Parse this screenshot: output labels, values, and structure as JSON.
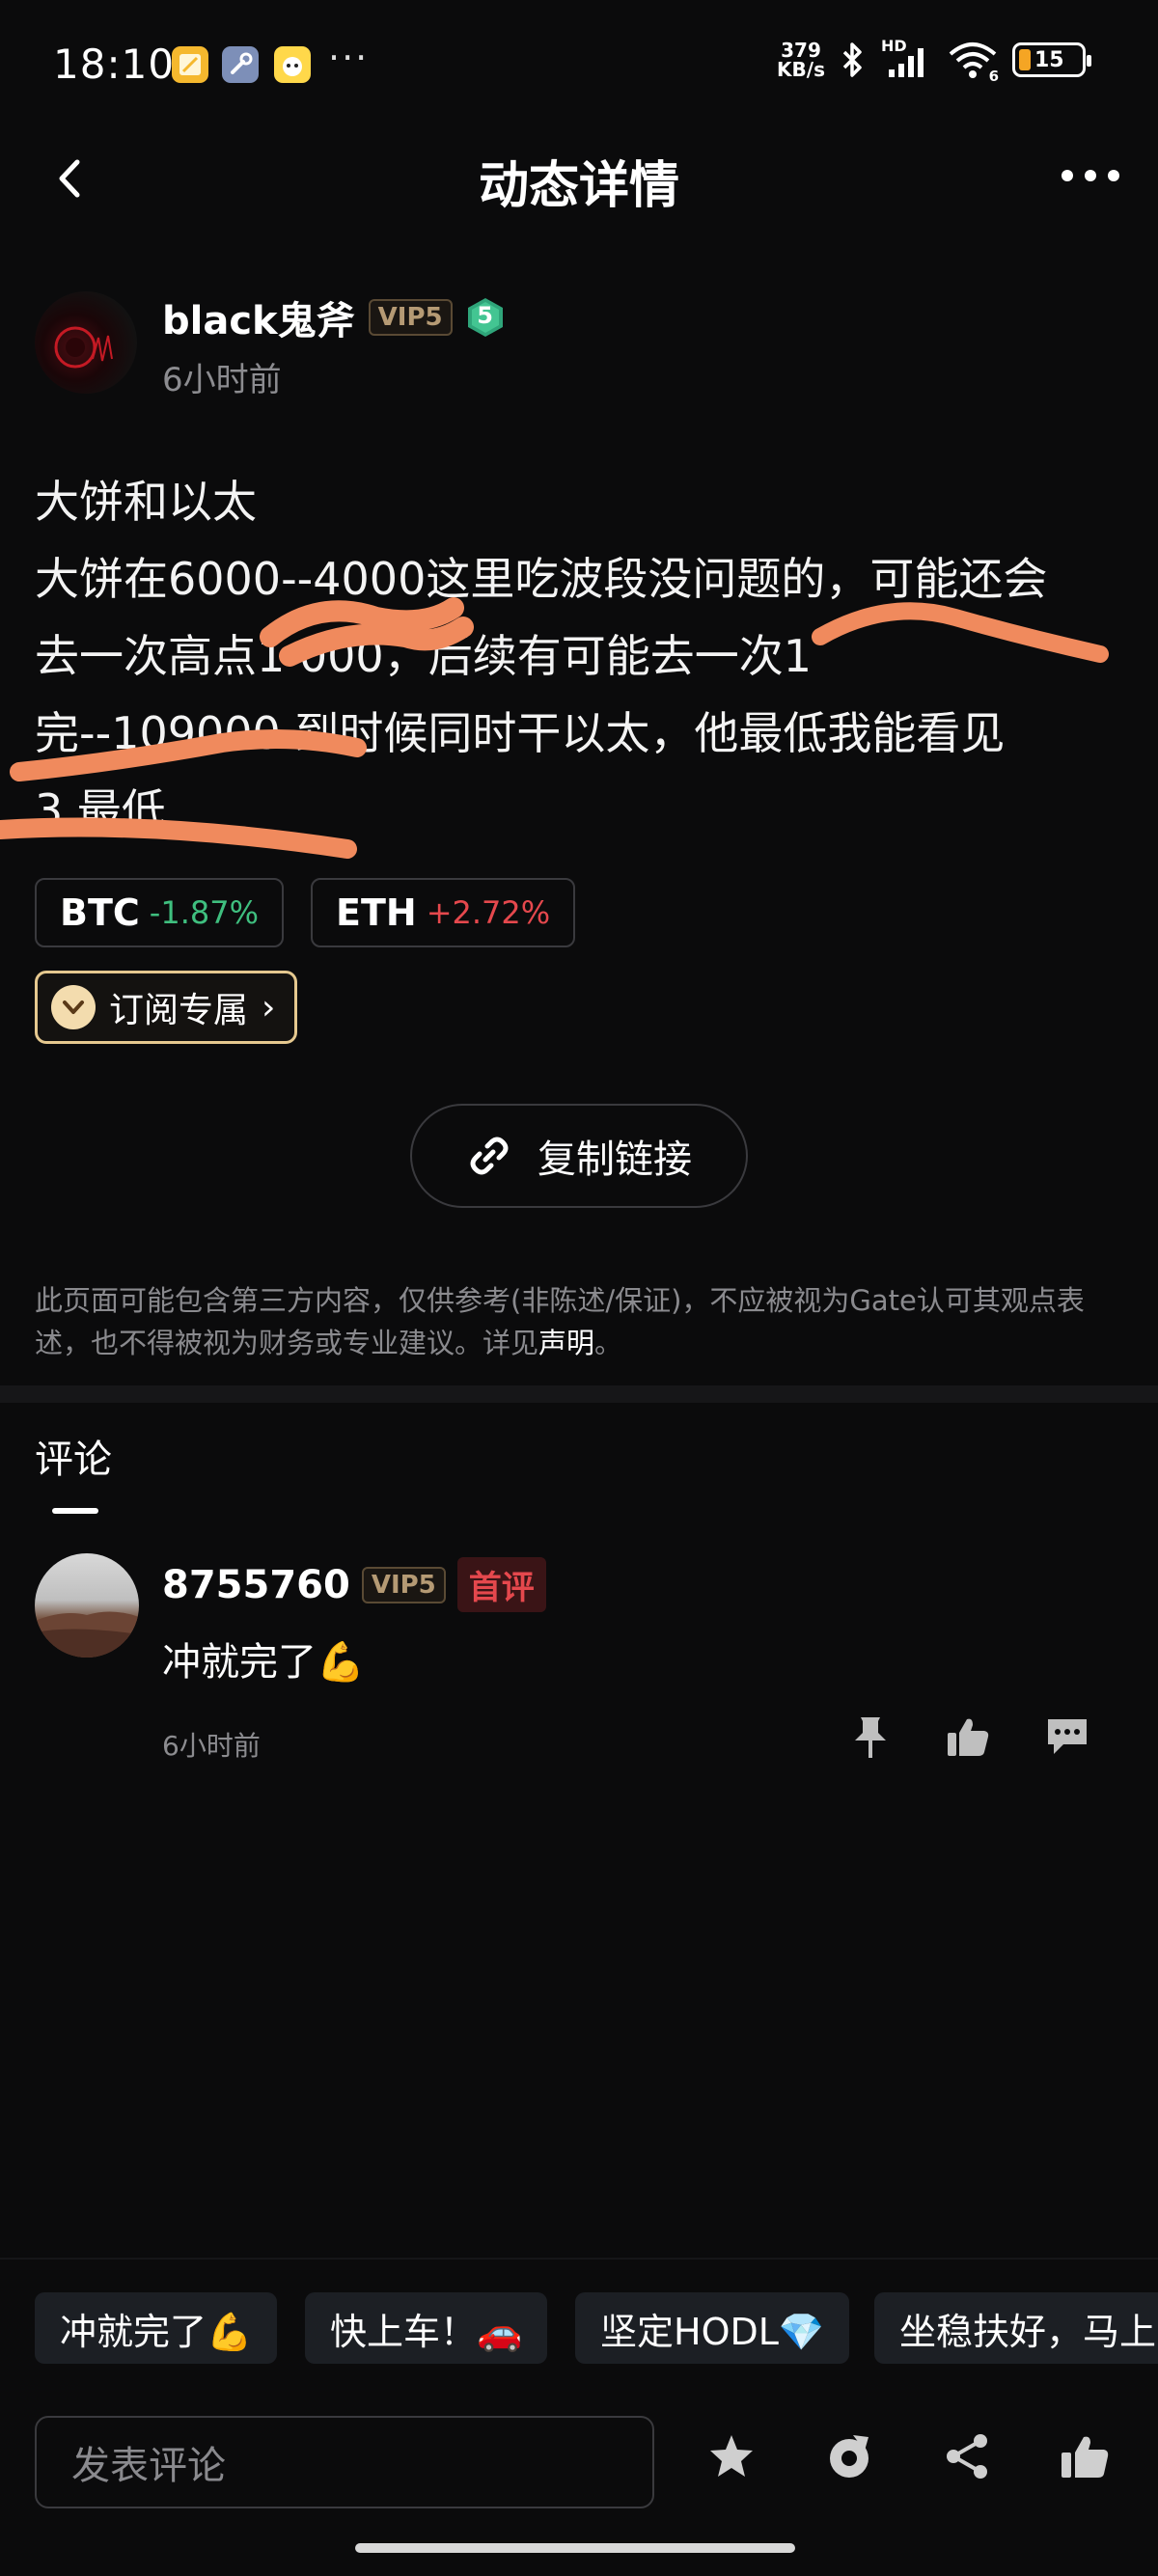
{
  "status_bar": {
    "time": "18:10",
    "net_speed_value": "379",
    "net_speed_unit": "KB/s",
    "battery": "15",
    "hd_label": "HD",
    "wifi_badge": "6",
    "more": "···"
  },
  "header": {
    "title": "动态详情"
  },
  "author": {
    "name": "black鬼斧",
    "vip": "VIP5",
    "level": "5",
    "time": "6小时前"
  },
  "post": {
    "lines": [
      "大饼和以太",
      "大饼在6000--4000这里吃波段没问题的，可能还会",
      "去一次高点1  000，后续有可能去一次1",
      "完--109000 到时候同时干以太，他最低我能看见",
      "3  最低"
    ]
  },
  "coins": [
    {
      "name": "BTC",
      "change": "-1.87%",
      "color": "#3fbf7f"
    },
    {
      "name": "ETH",
      "change": "+2.72%",
      "color": "#e5484d"
    }
  ],
  "subscribe": {
    "label": "订阅专属",
    "arrow": "›"
  },
  "copy_link": {
    "label": "复制链接"
  },
  "disclaimer": {
    "text": "此页面可能包含第三方内容，仅供参考(非陈述/保证)，不应被视为Gate认可其观点表述，也不得被视为财务或专业建议。详见",
    "link": "声明",
    "end": "。"
  },
  "comments": {
    "title": "评论",
    "items": [
      {
        "name": "8755760",
        "vip": "VIP5",
        "tag": "首评",
        "text": "冲就完了💪",
        "time": "6小时前"
      }
    ]
  },
  "quick_replies": [
    "冲就完了💪",
    "快上车！🚗",
    "坚定HODL💎",
    "坐稳扶好，马上"
  ],
  "comment_input": {
    "placeholder": "发表评论"
  },
  "colors": {
    "background": "#0b0b0c",
    "gain": "#e5484d",
    "loss": "#3fbf7f",
    "vip": "#b59a74",
    "subscribe_border": "#e5c88f",
    "scribble": "#f08a5d"
  }
}
